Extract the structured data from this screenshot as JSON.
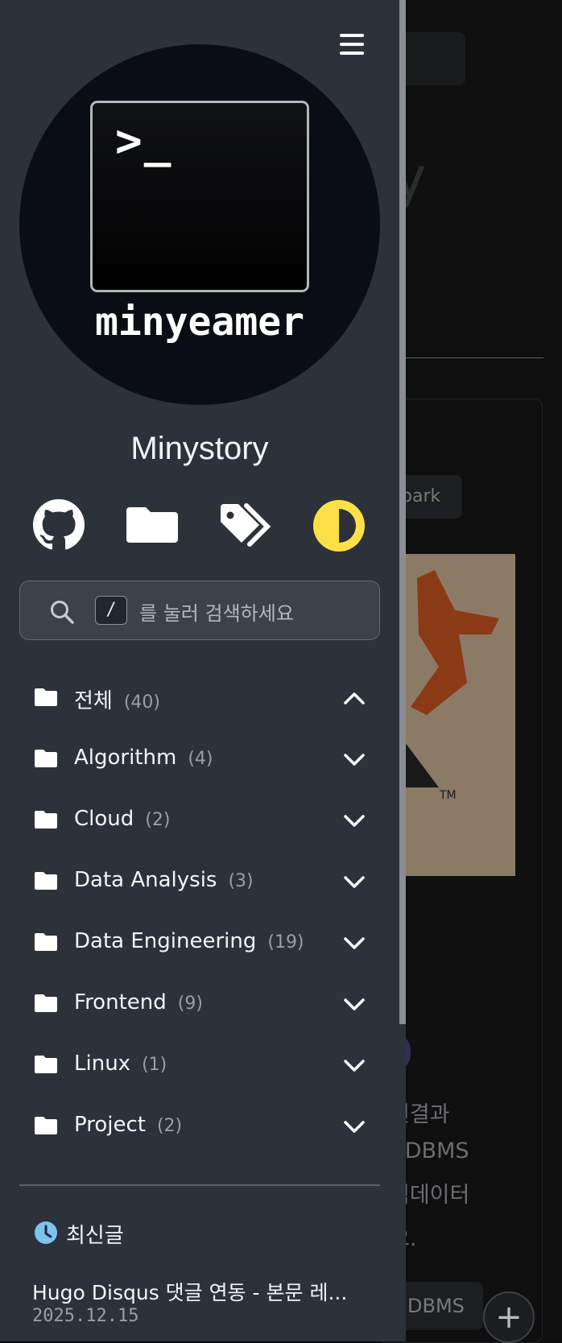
{
  "site": {
    "logo_text": "minyeamer",
    "prompt_text": ">_",
    "title": "Minystory"
  },
  "social_icons": [
    "github-icon",
    "folder-icon",
    "tags-icon",
    "theme-toggle-icon"
  ],
  "search": {
    "shortcut_key": "/",
    "placeholder": "를 눌러 검색하세요"
  },
  "categories": [
    {
      "name": "전체",
      "count": "(40)",
      "expanded": true
    },
    {
      "name": "Algorithm",
      "count": "(4)",
      "expanded": false
    },
    {
      "name": "Cloud",
      "count": "(2)",
      "expanded": false
    },
    {
      "name": "Data Analysis",
      "count": "(3)",
      "expanded": false
    },
    {
      "name": "Data Engineering",
      "count": "(19)",
      "expanded": false
    },
    {
      "name": "Frontend",
      "count": "(9)",
      "expanded": false
    },
    {
      "name": "Linux",
      "count": "(1)",
      "expanded": false
    },
    {
      "name": "Project",
      "count": "(2)",
      "expanded": false
    }
  ],
  "recent": {
    "heading": "최신글",
    "posts": [
      {
        "title": "Hugo Disqus 댓글 연동 - 본문 레...",
        "date": "2025.12.15"
      }
    ]
  },
  "background": {
    "chip": "park",
    "tm": "TM",
    "text_lines": [
      "연결과",
      "RDBMS",
      "빅데이터",
      "요."
    ],
    "button": "DBMS",
    "fab": "+"
  },
  "colors": {
    "sidebar_bg": "#2d313a",
    "theme_icon": "#fde047",
    "clock_icon": "#7cc4f0"
  }
}
